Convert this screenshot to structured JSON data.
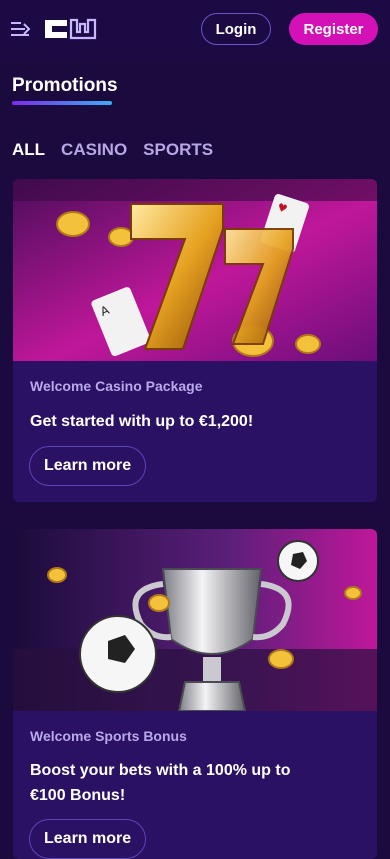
{
  "header": {
    "login_label": "Login",
    "register_label": "Register",
    "colors": {
      "register_bg": "#d411b6",
      "accent_blue": "#3aaef2"
    }
  },
  "page": {
    "title": "Promotions"
  },
  "tabs": [
    {
      "label": "ALL",
      "active": true
    },
    {
      "label": "CASINO",
      "active": false
    },
    {
      "label": "SPORTS",
      "active": false
    }
  ],
  "promotions": [
    {
      "category": "Welcome Casino Package",
      "headline": "Get started with up to €1,200!",
      "button_label": "Learn more"
    },
    {
      "category": "Welcome Sports Bonus",
      "headline": "Boost your bets with a 100% up to €100 Bonus!",
      "button_label": "Learn more"
    }
  ]
}
